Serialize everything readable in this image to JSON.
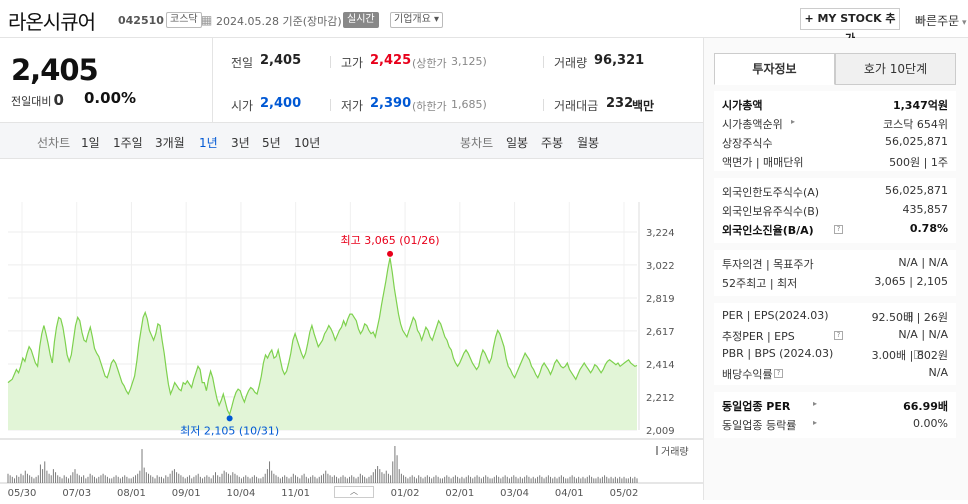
{
  "header": {
    "stock_name": "라온시큐어",
    "code": "042510",
    "market_badge": "코스닥",
    "date": "2024.05.28 기준(장마감)",
    "realtime_label": "실시간",
    "company_info_label": "기업개요",
    "my_stock_label": "+ MY STOCK 추가",
    "quick_order_label": "빠른주문"
  },
  "price": {
    "current": "2,405",
    "change_label": "전일대비",
    "change_value": "0",
    "change_pct": "0.00%"
  },
  "quote": {
    "prev_label": "전일",
    "prev": "2,405",
    "high_label": "고가",
    "high": "2,425",
    "upper_label": "(상한가",
    "upper": "3,125)",
    "volume_label": "거래량",
    "volume": "96,321",
    "open_label": "시가",
    "open": "2,400",
    "low_label": "저가",
    "low": "2,390",
    "lower_label": "(하한가",
    "lower": "1,685)",
    "amount_label": "거래대금",
    "amount": "232",
    "amount_unit": "백만"
  },
  "period_tabs": {
    "line_label": "선차트",
    "line_items": [
      "1일",
      "1주일",
      "3개월",
      "1년",
      "3년",
      "5년",
      "10년"
    ],
    "active": "1년",
    "candle_label": "봉차트",
    "candle_items": [
      "일봉",
      "주봉",
      "월봉"
    ]
  },
  "chart_data": {
    "type": "area",
    "y_ticks": [
      "3,224",
      "3,022",
      "2,819",
      "2,617",
      "2,414",
      "2,212",
      "2,009"
    ],
    "x_ticks": [
      "05/30",
      "07/03",
      "08/01",
      "09/01",
      "10/04",
      "11/01",
      "12/01",
      "01/02",
      "02/01",
      "03/04",
      "04/01",
      "05/02"
    ],
    "ylim": [
      2009,
      3224
    ],
    "max_label": "최고 3,065 (01/26)",
    "min_label": "최저 2,105 (10/31)",
    "volume_legend": "거래량",
    "values": [
      2300,
      2310,
      2320,
      2350,
      2380,
      2360,
      2400,
      2450,
      2430,
      2480,
      2520,
      2500,
      2460,
      2420,
      2400,
      2520,
      2600,
      2650,
      2600,
      2540,
      2470,
      2420,
      2550,
      2640,
      2700,
      2690,
      2640,
      2560,
      2470,
      2430,
      2470,
      2560,
      2650,
      2700,
      2680,
      2610,
      2560,
      2550,
      2600,
      2640,
      2580,
      2510,
      2480,
      2460,
      2420,
      2380,
      2340,
      2330,
      2370,
      2420,
      2440,
      2420,
      2380,
      2340,
      2300,
      2280,
      2250,
      2230,
      2260,
      2300,
      2340,
      2430,
      2540,
      2620,
      2700,
      2730,
      2690,
      2620,
      2590,
      2560,
      2600,
      2660,
      2650,
      2560,
      2480,
      2380,
      2290,
      2230,
      2260,
      2300,
      2280,
      2260,
      2250,
      2300,
      2290,
      2310,
      2290,
      2270,
      2320,
      2360,
      2400,
      2380,
      2300,
      2300,
      2250,
      2320,
      2370,
      2330,
      2260,
      2200,
      2160,
      2190,
      2230,
      2180,
      2130,
      2105,
      2150,
      2200,
      2240,
      2260,
      2250,
      2210,
      2180,
      2220,
      2250,
      2270,
      2260,
      2240,
      2230,
      2280,
      2340,
      2420,
      2470,
      2450,
      2480,
      2500,
      2450,
      2460,
      2500,
      2440,
      2380,
      2350,
      2370,
      2420,
      2480,
      2560,
      2600,
      2560,
      2520,
      2480,
      2450,
      2480,
      2540,
      2610,
      2650,
      2600,
      2560,
      2520,
      2540,
      2560,
      2600,
      2620,
      2650,
      2630,
      2600,
      2560,
      2590,
      2620,
      2640,
      2680,
      2650,
      2690,
      2720,
      2720,
      2700,
      2680,
      2630,
      2600,
      2620,
      2660,
      2650,
      2620,
      2600,
      2610,
      2580,
      2640,
      2700,
      2780,
      2850,
      2920,
      3000,
      3065,
      2980,
      2880,
      2800,
      2720,
      2660,
      2620,
      2600,
      2580,
      2620,
      2660,
      2700,
      2680,
      2620,
      2600,
      2560,
      2600,
      2640,
      2620,
      2580,
      2560,
      2600,
      2640,
      2680,
      2660,
      2620,
      2580,
      2560,
      2520,
      2500,
      2450,
      2420,
      2400,
      2420,
      2450,
      2480,
      2500,
      2480,
      2450,
      2420,
      2400,
      2380,
      2400,
      2460,
      2500,
      2480,
      2450,
      2420,
      2450,
      2520,
      2580,
      2620,
      2600,
      2560,
      2520,
      2450,
      2400,
      2380,
      2350,
      2330,
      2360,
      2390,
      2420,
      2450,
      2480,
      2460,
      2440,
      2400,
      2380,
      2350,
      2330,
      2360,
      2400,
      2420,
      2400,
      2380,
      2350,
      2380,
      2420,
      2440,
      2420,
      2400,
      2390,
      2400,
      2420,
      2380,
      2360,
      2340,
      2320,
      2350,
      2380,
      2400,
      2420,
      2400,
      2380,
      2360,
      2380,
      2410,
      2400,
      2380,
      2360,
      2380,
      2410,
      2430,
      2440,
      2430,
      2420,
      2410,
      2420,
      2400,
      2410,
      2420,
      2430,
      2440,
      2420,
      2410,
      2400,
      2405
    ],
    "volumes": [
      6,
      5,
      4,
      3,
      5,
      4,
      6,
      5,
      8,
      6,
      5,
      4,
      3,
      4,
      5,
      12,
      9,
      14,
      8,
      6,
      5,
      9,
      7,
      5,
      4,
      3,
      5,
      4,
      3,
      5,
      7,
      9,
      6,
      5,
      4,
      5,
      3,
      4,
      6,
      5,
      4,
      3,
      4,
      5,
      6,
      5,
      4,
      3,
      3,
      4,
      5,
      4,
      3,
      4,
      5,
      4,
      3,
      3,
      4,
      5,
      6,
      8,
      22,
      10,
      7,
      6,
      5,
      4,
      3,
      5,
      4,
      4,
      3,
      5,
      4,
      6,
      8,
      9,
      7,
      6,
      5,
      4,
      3,
      4,
      5,
      3,
      4,
      5,
      6,
      4,
      3,
      4,
      5,
      4,
      3,
      5,
      7,
      5,
      4,
      6,
      8,
      7,
      6,
      5,
      7,
      6,
      5,
      4,
      3,
      4,
      5,
      4,
      3,
      4,
      5,
      4,
      3,
      3,
      4,
      6,
      9,
      14,
      8,
      6,
      5,
      4,
      3,
      4,
      5,
      4,
      3,
      4,
      6,
      5,
      4,
      3,
      5,
      6,
      4,
      3,
      4,
      5,
      4,
      3,
      4,
      5,
      6,
      8,
      6,
      5,
      4,
      5,
      4,
      3,
      4,
      5,
      4,
      3,
      4,
      5,
      4,
      3,
      4,
      6,
      5,
      4,
      3,
      4,
      5,
      7,
      9,
      11,
      9,
      7,
      6,
      8,
      6,
      5,
      14,
      24,
      18,
      9,
      6,
      5,
      4,
      3,
      4,
      5,
      4,
      3,
      5,
      4,
      3,
      4,
      5,
      4,
      3,
      4,
      5,
      4,
      3,
      3,
      4,
      5,
      4,
      3,
      4,
      5,
      4,
      3,
      4,
      3,
      4,
      5,
      4,
      3,
      4,
      5,
      4,
      3,
      4,
      5,
      4,
      3,
      3,
      4,
      5,
      4,
      3,
      4,
      5,
      4,
      3,
      4,
      5,
      4,
      3,
      4,
      3,
      4,
      5,
      4,
      3,
      4,
      3,
      4,
      5,
      4,
      3,
      4,
      5,
      4,
      3,
      4,
      3,
      4,
      5,
      4,
      3,
      3,
      4,
      5,
      4,
      3,
      4,
      3,
      4,
      3,
      4,
      5,
      4,
      3,
      3,
      4,
      3,
      4,
      5,
      4,
      3,
      4,
      3,
      4,
      3,
      4,
      3,
      4,
      3,
      3,
      4,
      3,
      4,
      3
    ]
  },
  "invest_tabs": [
    "투자정보",
    "호가 10단계"
  ],
  "invest": {
    "s1": [
      {
        "k": "시가총액",
        "v": "1,347억원",
        "bold": true
      },
      {
        "k": "시가총액순위",
        "v": "코스닥 654위"
      },
      {
        "k": "상장주식수",
        "v": "56,025,871"
      },
      {
        "k": "액면가 | 매매단위",
        "v": "500원 | 1주"
      }
    ],
    "s2": [
      {
        "k": "외국인한도주식수(A)",
        "v": "56,025,871"
      },
      {
        "k": "외국인보유주식수(B)",
        "v": "435,857"
      },
      {
        "k": "외국인소진율(B/A)",
        "v": "0.78%",
        "bold": true
      }
    ],
    "s3": [
      {
        "k": "투자의견 | 목표주가",
        "v": "N/A | N/A"
      },
      {
        "k": "52주최고 | 최저",
        "v": "3,065 | 2,105"
      }
    ],
    "s4": [
      {
        "k": "PER | EPS(2024.03)",
        "v": "92.50배 | 26원"
      },
      {
        "k": "추정PER | EPS",
        "v": "N/A | N/A"
      },
      {
        "k": "PBR | BPS (2024.03)",
        "v": "3.00배 | 802원"
      },
      {
        "k": "배당수익률",
        "v": "N/A"
      }
    ],
    "s5": [
      {
        "k": "동일업종 PER",
        "v": "66.99배",
        "bold": true
      },
      {
        "k": "동일업종 등락률",
        "v": "0.00%"
      }
    ]
  },
  "colors": {
    "up": "#e8001b",
    "down": "#0058d4",
    "chart_line": "#7ed14e",
    "chart_fill": "#e2f5d7"
  }
}
